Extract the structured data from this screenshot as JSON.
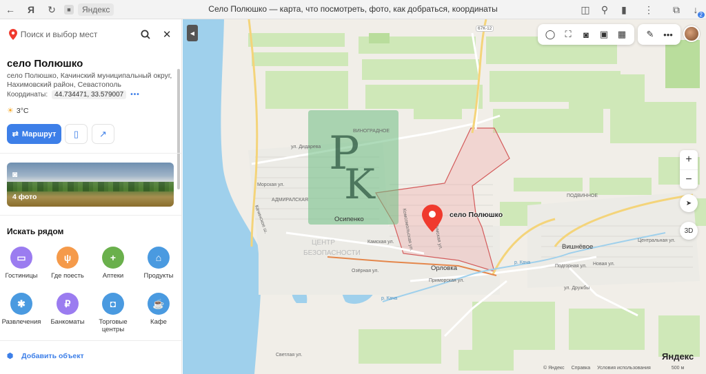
{
  "browser": {
    "domain": "Яндекс",
    "page_title": "Село Полюшко — карта, что посмотреть, фото, как добраться, координаты",
    "tabs_count": "2"
  },
  "search": {
    "placeholder": "Поиск и выбор мест"
  },
  "place": {
    "title": "село Полюшко",
    "address": "село Полюшко, Качинский муниципальный округ, Нахимовский район, Севастополь",
    "coords_label": "Координаты:",
    "coords_value": "44.734471, 33.579007",
    "coords_more": "•••",
    "weather": "3°C",
    "route_label": "Маршрут"
  },
  "photos": {
    "label": "4 фото"
  },
  "nearby": {
    "title": "Искать рядом",
    "items": [
      {
        "label": "Гостиницы",
        "color": "#9b7cf0",
        "icon": "bed-icon"
      },
      {
        "label": "Где поесть",
        "color": "#f59a4a",
        "icon": "fork-knife-icon"
      },
      {
        "label": "Аптеки",
        "color": "#6ab04c",
        "icon": "plus-icon"
      },
      {
        "label": "Продукты",
        "color": "#4a9ae0",
        "icon": "basket-icon"
      },
      {
        "label": "Развлечения",
        "color": "#4a9ae0",
        "icon": "ferris-wheel-icon"
      },
      {
        "label": "Банкоматы",
        "color": "#9b7cf0",
        "icon": "ruble-icon"
      },
      {
        "label": "Торговые центры",
        "color": "#4a9ae0",
        "icon": "shopping-bag-icon"
      },
      {
        "label": "Кафе",
        "color": "#4a9ae0",
        "icon": "cup-icon"
      }
    ]
  },
  "add_object": "Добавить объект",
  "map": {
    "pin_label": "село Полюшко",
    "road_badge_1": "67К-12",
    "labels": {
      "vinogradnoe": "ВИНОГРАДНОЕ",
      "darlings": "ул. Дидарева",
      "morskaya": "Морская ул.",
      "admiralskaya": "АДМИРАЛСКАЯ",
      "kachinskoe": "Качинское ш.",
      "osipenko": "Осипенко",
      "komsomolskaya": "Комсомольская ул.",
      "kamskaya": "Камская ул.",
      "sumskaya": "Сумская ул.",
      "ozernaya": "Озёрная ул.",
      "orlovka": "Орловка",
      "primorskaya": "Приморская ул.",
      "kacha_river": "р. Кача",
      "vishnevoe": "Вишнёвое",
      "tsentralnaya": "Центральная ул.",
      "kacha_river_2": "р. Кача",
      "podgornaya": "Подгорная ул.",
      "novaya": "Новая ул.",
      "druzhby": "ул. Дружбы",
      "podvinnoe": "ПОДВИННОЕ",
      "svetlaya": "Светлая ул.",
      "centr": "ЦЕНТР",
      "bezopasnosti": "БЕЗОПАСНОСТИ"
    },
    "zoom_in": "+",
    "zoom_out": "−",
    "three_d": "3D",
    "logo": "Яндекс",
    "footer": {
      "copyright": "© Яндекс",
      "help": "Справка",
      "terms": "Условия использования",
      "scale": "500 м"
    }
  }
}
